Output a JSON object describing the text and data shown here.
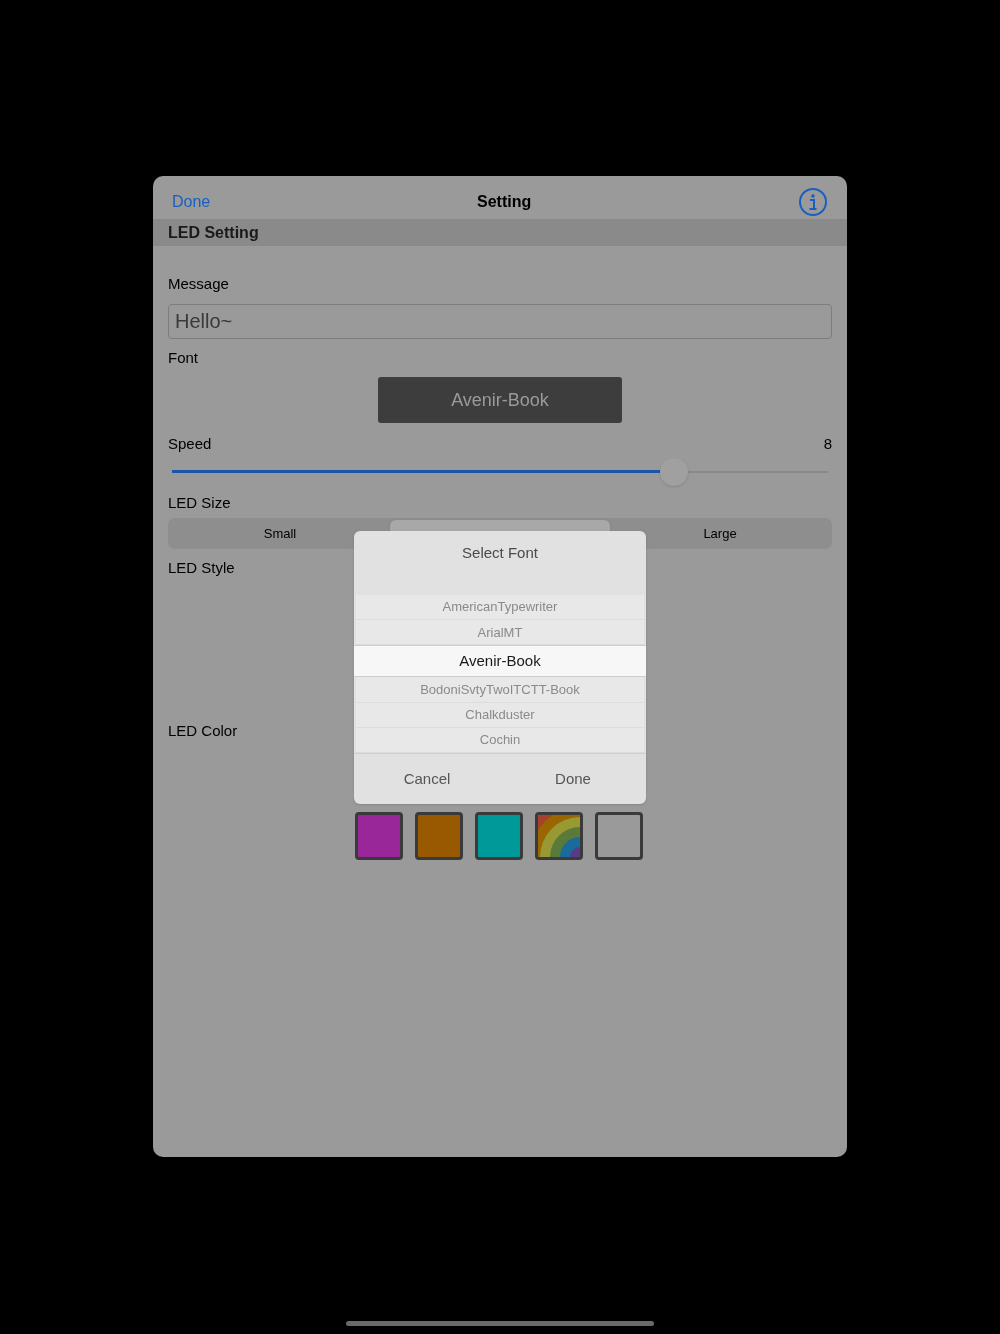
{
  "nav": {
    "left_button": "Done",
    "title": "Setting"
  },
  "section_header": "LED Setting",
  "message": {
    "label": "Message",
    "value": "Hello~"
  },
  "font": {
    "label": "Font",
    "button": "Avenir-Book"
  },
  "speed": {
    "label": "Speed",
    "reading": "8",
    "level": 0.765
  },
  "led_size": {
    "label": "LED Size",
    "segments": [
      {
        "label": "Small",
        "selected": false
      },
      {
        "selected": true
      },
      {
        "label": "Large",
        "selected": false
      }
    ]
  },
  "led_style": {
    "label": "LED Style"
  },
  "led_color": {
    "label": "LED Color",
    "swatches": [
      {
        "kind": "solid",
        "color": "#992799"
      },
      {
        "kind": "solid",
        "color": "#995900"
      },
      {
        "kind": "solid",
        "color": "#009999"
      },
      {
        "kind": "rainbow"
      },
      {
        "kind": "solid",
        "color": "#9a9a9a"
      }
    ]
  },
  "font_picker": {
    "title": "Select Font",
    "options": [
      {
        "label": "AmericanTypewriter",
        "selected": false
      },
      {
        "label": "ArialMT",
        "selected": false
      },
      {
        "label": "Avenir-Book",
        "selected": true
      },
      {
        "label": "BodoniSvtyTwoITCTT-Book",
        "selected": false
      },
      {
        "label": "Chalkduster",
        "selected": false
      },
      {
        "label": "Cochin",
        "selected": false
      }
    ],
    "buttons": [
      "Cancel",
      "Done"
    ]
  }
}
